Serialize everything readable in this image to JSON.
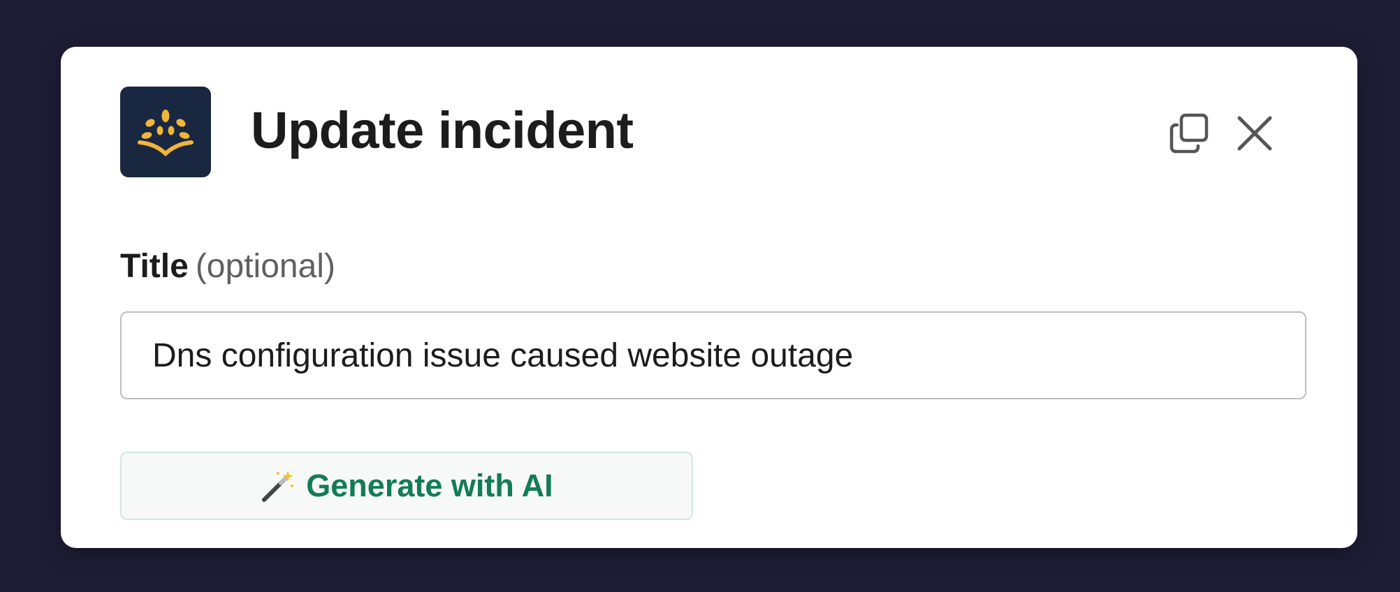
{
  "modal": {
    "title": "Update incident"
  },
  "icons": {
    "logo": "sprout-logo-icon",
    "copy": "copy-icon",
    "close": "close-icon",
    "wand": "magic-wand-icon"
  },
  "form": {
    "title_label": "Title",
    "title_optional": "(optional)",
    "title_value": "Dns configuration issue caused website outage"
  },
  "actions": {
    "generate_label": "Generate with AI"
  },
  "colors": {
    "backdrop": "#1f1d35",
    "logo_bg": "#1a2740",
    "logo_fg": "#f0b53a",
    "accent_green": "#127c55"
  }
}
